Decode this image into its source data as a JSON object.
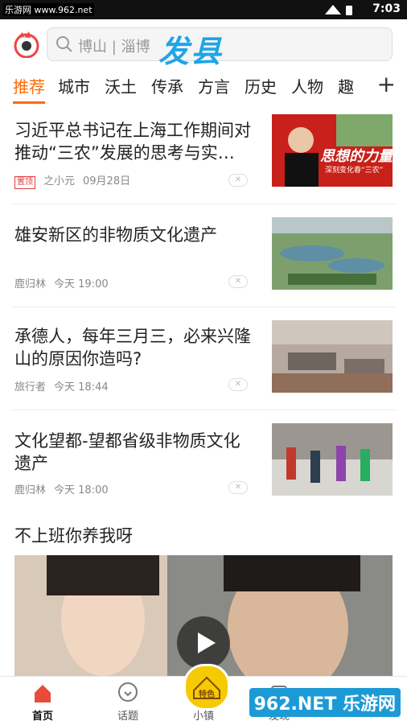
{
  "status_bar": {
    "source": "乐游网 www.962.net",
    "time": "7:03"
  },
  "search": {
    "placeholder": "博山 | 淄博",
    "overlay_text": "发县"
  },
  "tabs": [
    "推荐",
    "城市",
    "沃土",
    "传承",
    "方言",
    "历史",
    "人物",
    "趣"
  ],
  "tabs_more_icon": "plus-icon",
  "feed": [
    {
      "title": "习近平总书记在上海工作期间对推动“三农”发展的思考与实…",
      "tag": "置顶",
      "source": "之小元",
      "time": "09月28日",
      "thumb_text": "思想的力量",
      "thumb_sub": "深刻变化春“三农”"
    },
    {
      "title": "雄安新区的非物质文化遗产",
      "source": "鹿归林",
      "time": "今天 19:00"
    },
    {
      "title": "承德人，每年三月三，必来兴隆山的原因你造吗?",
      "source": "旅行者",
      "time": "今天 18:44"
    },
    {
      "title": "文化望都-望都省级非物质文化遗产",
      "source": "鹿归林",
      "time": "今天 18:00"
    }
  ],
  "video": {
    "title": "不上班你养我呀"
  },
  "bottom_nav": [
    {
      "label": "首页",
      "icon": "home-icon"
    },
    {
      "label": "话题",
      "icon": "topic-icon"
    },
    {
      "label": "小镇",
      "icon": "town-icon",
      "badge_text": "特色"
    },
    {
      "label": "发现",
      "icon": "discover-icon"
    }
  ],
  "watermark": "962.NET 乐游网",
  "colors": {
    "accent": "#ff6a00",
    "overlay_blue": "#1da6e6"
  }
}
